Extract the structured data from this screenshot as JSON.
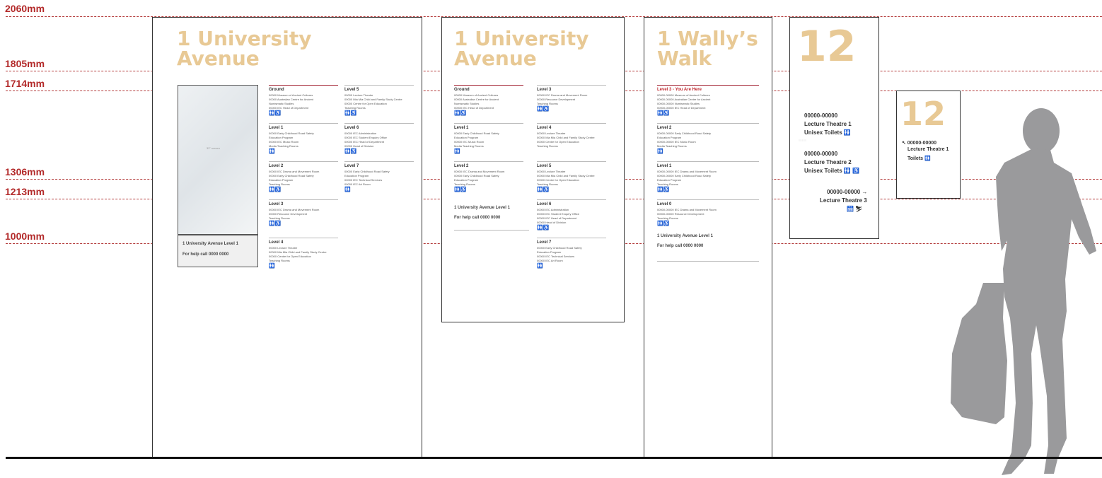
{
  "heights": [
    {
      "label": "2060mm"
    },
    {
      "label": "1805mm"
    },
    {
      "label": "1714mm"
    },
    {
      "label": "1306mm"
    },
    {
      "label": "1213mm"
    },
    {
      "label": "1000mm"
    }
  ],
  "sign1": {
    "title": "1 University\nAvenue",
    "screen_caption": "32\" screen",
    "screen_footer": {
      "line1": "1 University Avenue Level 1",
      "line2": "For help call 0000 0000"
    },
    "col_left": [
      {
        "heading": "Ground",
        "rows": [
          "00000  Museum of Ancient Cultures",
          "00000  Australian Centre for Ancient",
          "           Numismatic Studies",
          "00000  IEC Head of Department"
        ],
        "icons": "🚻♿"
      },
      {
        "heading": "Level 1",
        "rows": [
          "00000  Early Childhood Road Safety",
          "           Education Program",
          "00000  IEC Music Room",
          "Media Teaching Rooms"
        ],
        "icons": "🚻"
      },
      {
        "heading": "Level 2",
        "rows": [
          "00000  IEC Drama and Movement Room",
          "00000  Early Childhood Road Safety",
          "           Education Program",
          "Teaching Rooms"
        ],
        "icons": "🚻♿"
      },
      {
        "heading": "Level 3",
        "rows": [
          "00000  IEC Drama and Movement Room",
          "00000  Resource Development",
          "Teaching Rooms"
        ],
        "icons": "🚻♿"
      },
      {
        "heading": "Level 4",
        "rows": [
          "00000  Lecture Theatre",
          "00000  Mia Mia Child and Family Study Centre",
          "00000  Centre for Open Education",
          "Teaching Rooms"
        ],
        "icons": "🚻"
      }
    ],
    "col_right": [
      {
        "heading": "Level 5",
        "rows": [
          "00000  Lecture Theatre",
          "00000  Mia Mia Child and Family Study Centre",
          "00000  Centre for Open Education",
          "Teaching Rooms"
        ],
        "icons": "🚻♿"
      },
      {
        "heading": "Level 6",
        "rows": [
          "00000  IEC Administration",
          "00000  IEC Student Enquiry Office",
          "00000  IEC Head of Department",
          "00000  Head of Division"
        ],
        "icons": "🚻♿"
      },
      {
        "heading": "Level 7",
        "rows": [
          "00000  Early Childhood Road Safety",
          "           Education Program",
          "00000  IEC Technical Services",
          "00000  IEC Art Room"
        ],
        "icons": "🚻"
      }
    ]
  },
  "sign2": {
    "title": "1 University\nAvenue",
    "footer": {
      "line1": "1 University Avenue Level 1",
      "line2": "For help call 0000 0000"
    },
    "col_left": [
      {
        "heading": "Ground",
        "rows": [
          "00000  Museum of Ancient Cultures",
          "00000  Australian Centre for Ancient",
          "           Numismatic Studies",
          "00000  IEC Head of Department"
        ],
        "icons": "🚻♿"
      },
      {
        "heading": "Level 1",
        "rows": [
          "00000  Early Childhood Road Safety",
          "           Education Program",
          "00000  IEC Music Room",
          "Media Teaching Rooms"
        ],
        "icons": "🚻"
      },
      {
        "heading": "Level 2",
        "rows": [
          "00000  IEC Drama and Movement Room",
          "00000  Early Childhood Road Safety",
          "           Education Program",
          "Teaching Rooms"
        ],
        "icons": "🚻♿"
      }
    ],
    "col_right": [
      {
        "heading": "Level 3",
        "rows": [
          "00000  IEC Drama and Movement Room",
          "00000  Resource Development",
          "Teaching Rooms"
        ],
        "icons": "🚻♿"
      },
      {
        "heading": "Level 4",
        "rows": [
          "00000  Lecture Theatre",
          "00000  Mia Mia Child and Family Study Centre",
          "00000  Centre for Open Education",
          "Teaching Rooms"
        ],
        "icons": ""
      },
      {
        "heading": "Level 5",
        "rows": [
          "00000  Lecture Theatre",
          "00000  Mia Mia Child and Family Study Centre",
          "00000  Centre for Open Education",
          "Teaching Rooms"
        ],
        "icons": "🚻♿"
      },
      {
        "heading": "Level 6",
        "rows": [
          "00000  IEC Administration",
          "00000  IEC Student Enquiry Office",
          "00000  IEC Head of Department",
          "00000  Head of Division"
        ],
        "icons": "🚻♿"
      },
      {
        "heading": "Level 7",
        "rows": [
          "00000  Early Childhood Road Safety",
          "           Education Program",
          "00000  IEC Technical Services",
          "00000  IEC Art Room"
        ],
        "icons": "🚻"
      }
    ]
  },
  "sign3": {
    "title": "1 Wally’s\nWalk",
    "footer": {
      "line1": "1 University Avenue Level 1",
      "line2": "For help call 0000 0000"
    },
    "sections": [
      {
        "heading": "Level 3 - You Are Here",
        "here": true,
        "rows": [
          "00000-00000 Museum of Ancient Cultures",
          "00000-00000 Australian Centre for Ancient",
          "00000-00000 Numismatic Studies",
          "00000-00000 IEC Head of Department"
        ],
        "icons": "🚻♿"
      },
      {
        "heading": "Level 2",
        "here": false,
        "rows": [
          "00000-00000 Early Childhood Road Safety",
          "                     Education Program",
          "00000-00000 IEC Music Room",
          "                     Media Teaching Rooms"
        ],
        "icons": "🚻"
      },
      {
        "heading": "Level 1",
        "here": false,
        "rows": [
          "00000-00000 IEC Drama and Movement Room",
          "00000-00000 Early Childhood Road Safety",
          "                     Education Program",
          "Teaching Rooms"
        ],
        "icons": "🚻♿"
      },
      {
        "heading": "Level 0",
        "here": false,
        "rows": [
          "00000-00000 IEC Drama and Movement Room",
          "00000-00000 Resource Development",
          "Teaching Rooms"
        ],
        "icons": "🚻♿"
      }
    ]
  },
  "sign4": {
    "number": "12",
    "entries": [
      {
        "code": "00000-00000",
        "name": "Lecture Theatre 1",
        "extra": "Unisex Toilets 🚻"
      },
      {
        "code": "00000-00000",
        "name": "Lecture Theatre 2",
        "extra": "Unisex Toilets 🚻 ♿"
      }
    ],
    "entry3": {
      "code": "00000-00000 →",
      "name": "Lecture Theatre 3",
      "icons": "🛗 ⛷"
    }
  },
  "sign5": {
    "number": "12",
    "code": "↖ 00000-00000",
    "name": "Lecture Theatre 1",
    "extra": "Toilets 🚻"
  },
  "colors": {
    "accent": "#b32a2a",
    "title": "#e8c995",
    "accessible": "#1565c0",
    "silhouette": "#9a9a9c"
  }
}
